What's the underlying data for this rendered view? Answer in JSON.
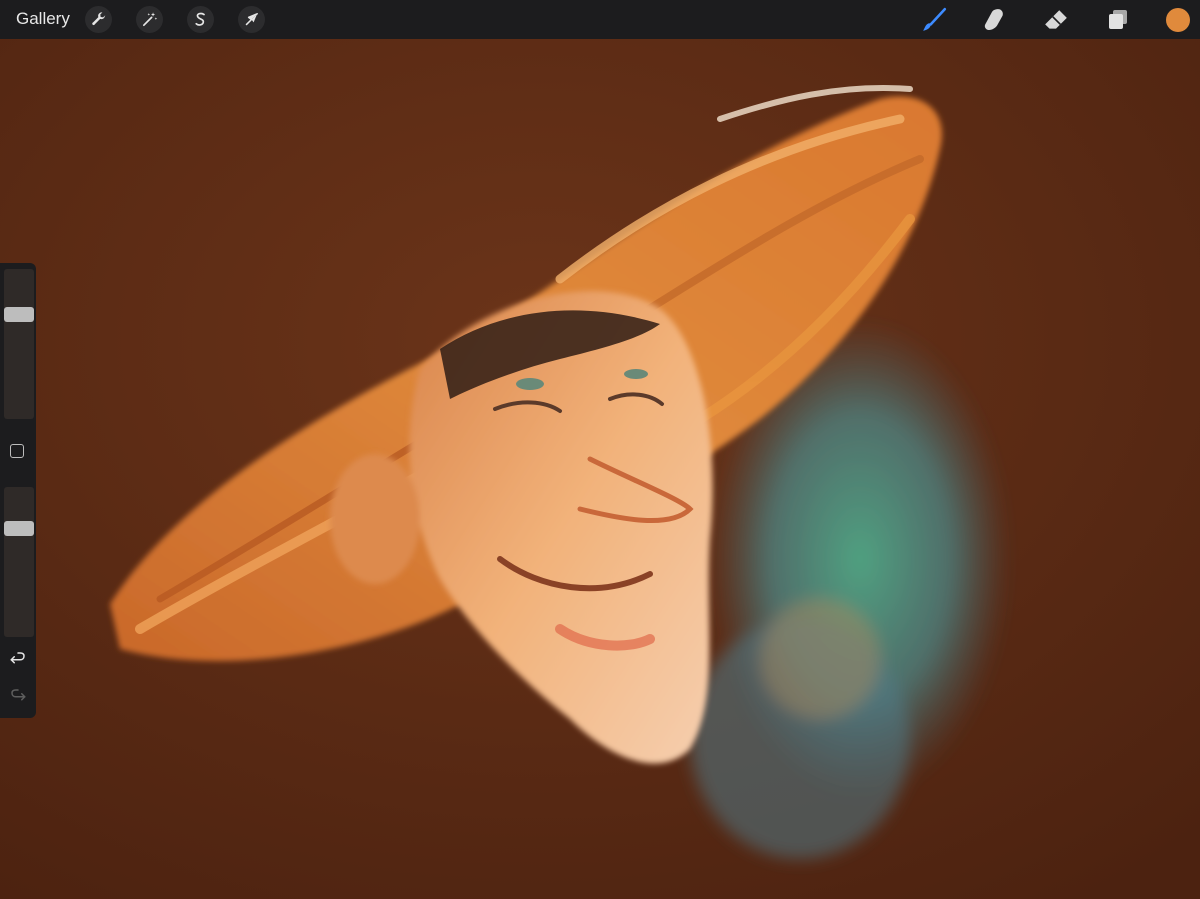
{
  "topbar": {
    "gallery_label": "Gallery",
    "left_tools": [
      {
        "name": "actions",
        "icon": "wrench-icon"
      },
      {
        "name": "adjustments",
        "icon": "magic-wand-icon"
      },
      {
        "name": "selection",
        "icon": "selection-s-icon"
      },
      {
        "name": "transform",
        "icon": "arrow-cursor-icon"
      }
    ],
    "right_tools": [
      {
        "name": "brush",
        "icon": "brush-icon",
        "active": true
      },
      {
        "name": "smudge",
        "icon": "smudge-finger-icon",
        "active": false
      },
      {
        "name": "eraser",
        "icon": "eraser-icon",
        "active": false
      },
      {
        "name": "layers",
        "icon": "layers-icon",
        "active": false
      }
    ],
    "current_color": "#e08a3c"
  },
  "sidebar": {
    "brush_size_level": 0.72,
    "opacity_level": 0.75,
    "modifier_icon": "square-modifier-icon",
    "undo_icon": "undo-icon",
    "redo_icon": "redo-icon",
    "redo_enabled": false
  },
  "colors": {
    "accent_active_tool": "#3d8bff",
    "canvas_bg": "#5a2a14",
    "toolbar_bg": "#1c1c1e"
  }
}
